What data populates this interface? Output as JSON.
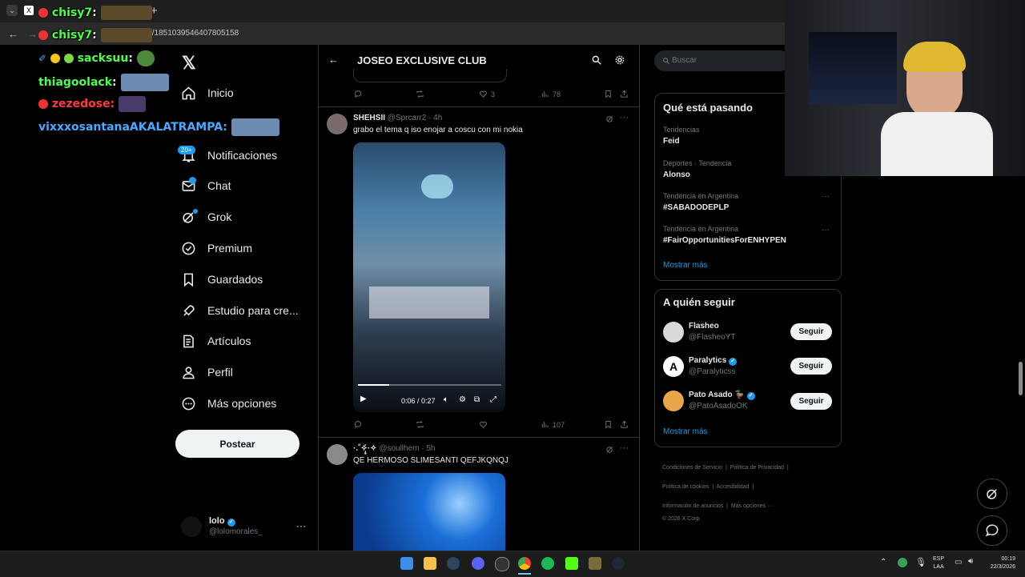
{
  "browser": {
    "url": "ities/1851039546407805158"
  },
  "chat": [
    {
      "user": "chisy7",
      "sep": ":",
      "color": "#4cff4c"
    },
    {
      "user": "chisy7",
      "sep": ":",
      "color": "#4cff4c"
    },
    {
      "user": "sacksuu",
      "sep": ":",
      "color": "#4cff4c"
    },
    {
      "user": "thiagoolack",
      "sep": ":",
      "color": "#4cff4c"
    },
    {
      "user": "zezedose",
      "sep": ":",
      "color": "#ff3b3b"
    },
    {
      "user": "vixxxosantanaAKALATRAMPA",
      "sep": ":",
      "color": "#4aa8ff"
    }
  ],
  "nav": {
    "items": [
      {
        "label": "Inicio",
        "icon": "home-icon"
      },
      {
        "label": "Notificaciones",
        "icon": "bell-icon",
        "badge": "20+"
      },
      {
        "label": "Chat",
        "icon": "mail-icon"
      },
      {
        "label": "Grok",
        "icon": "grok-icon"
      },
      {
        "label": "Premium",
        "icon": "premium-icon"
      },
      {
        "label": "Guardados",
        "icon": "bookmark-icon"
      },
      {
        "label": "Estudio para cre...",
        "icon": "rocket-icon"
      },
      {
        "label": "Artículos",
        "icon": "article-icon"
      },
      {
        "label": "Perfil",
        "icon": "user-icon"
      },
      {
        "label": "Más opciones",
        "icon": "more-circle-icon"
      }
    ],
    "post_label": "Postear",
    "account": {
      "name": "lolo",
      "handle": "@lolomorales_"
    }
  },
  "main": {
    "title": "JOSEO EXCLUSIVE CLUB",
    "top_actions": {
      "likes": "3",
      "views": "78"
    },
    "post1": {
      "name": "SHEHSII",
      "handle": "@Sprcarr2",
      "time": "· 4h",
      "text": "grabo el tema q iso enojar a coscu con mi nokia",
      "video_time": "0:06 / 0:27",
      "video_progress": 0.22,
      "views": "107"
    },
    "post2": {
      "name": "·.˚✧̣̥̇·✧",
      "handle": "@soullhem",
      "time": "· 5h",
      "text": "QE HERMOSO SLIMESANTI QEFJKQNQJ"
    }
  },
  "right": {
    "search_placeholder": "Buscar",
    "trends_title": "Qué está pasando",
    "trends": [
      {
        "sub": "Tendencias",
        "name": "Feid"
      },
      {
        "sub": "Deportes · Tendencia",
        "name": "Alonso"
      },
      {
        "sub": "Tendencia en Argentina",
        "name": "#SABADODEPLP"
      },
      {
        "sub": "Tendencia en Argentina",
        "name": "#FairOpportunitiesForENHYPEN"
      }
    ],
    "show_more": "Mostrar más",
    "follow_title": "A quién seguir",
    "follow": [
      {
        "name": "Flasheo",
        "handle": "@FlasheoYT",
        "verified": false
      },
      {
        "name": "Paralytics",
        "handle": "@Paralyticss",
        "verified": true
      },
      {
        "name": "Pato Asado 🦆",
        "handle": "@PatoAsadoOK",
        "verified": true
      }
    ],
    "follow_btn": "Seguir",
    "follow_more": "Mostrar más",
    "footer": {
      "row1": [
        "Condiciones de Servicio",
        "Política de Privacidad"
      ],
      "row2": [
        "Política de cookies",
        "Accesibilidad"
      ],
      "row3": [
        "Información de anuncios",
        "Más opciones ···"
      ],
      "copyright": "© 2026 X Corp."
    }
  },
  "taskbar": {
    "lang1": "ESP",
    "lang2": "LAA",
    "time": "00:19",
    "date": "22/3/2026"
  }
}
